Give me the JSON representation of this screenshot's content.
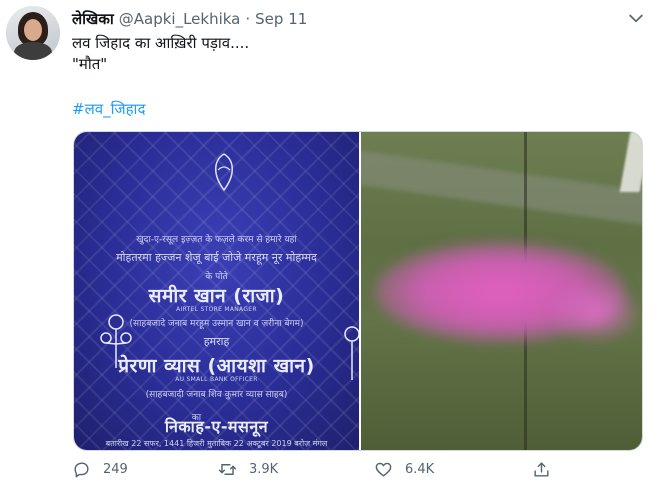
{
  "tweet": {
    "display_name": "लेखिका",
    "handle": "@Aapki_Lekhika",
    "separator": "·",
    "date": "Sep 11",
    "text_line1": "लव जिहाद का आख़िरी पड़ाव....",
    "text_line2": "\"मौत\"",
    "hashtag": "#लव_जिहाद"
  },
  "media": {
    "left_image": {
      "line1": "खुदा-ए-रसूल इज़्ज़त के फज़ले करम से हमारे यहां",
      "line2": "मोहतरमा हज्जन शेजू बाई जोजे मरहूम नूर मोहम्मद",
      "line3": "के पोते",
      "groom": "समीर खान (राजा)",
      "groom_title": "AIRTEL STORE MANAGER",
      "groom_parent": "(साहबजादे जनाब मरहूम उस्मान खान व ज़रीना बेगम)",
      "sang": "हमराह",
      "bride": "प्रेरणा व्यास (आयशा खान)",
      "bride_title": "AU SMALL BANK OFFICER",
      "bride_parent": "(साहबजादी जनाब शिव कुमार व्यास साहब)",
      "ka": "का",
      "nikah": "निकाह-ए-मसनून",
      "date_line": "बतारीख 22 सफर, 1441 हिजरी मुताबिक 22 अक्टूबर 2019 बरोज़ मंगल"
    }
  },
  "actions": {
    "replies": "249",
    "retweets": "3.9K",
    "likes": "6.4K"
  },
  "colors": {
    "text": "#0f1419",
    "muted": "#536471",
    "accent": "#1d9bf0"
  },
  "icons": [
    "more-chevron-icon",
    "reply-icon",
    "retweet-icon",
    "like-icon",
    "share-icon"
  ]
}
